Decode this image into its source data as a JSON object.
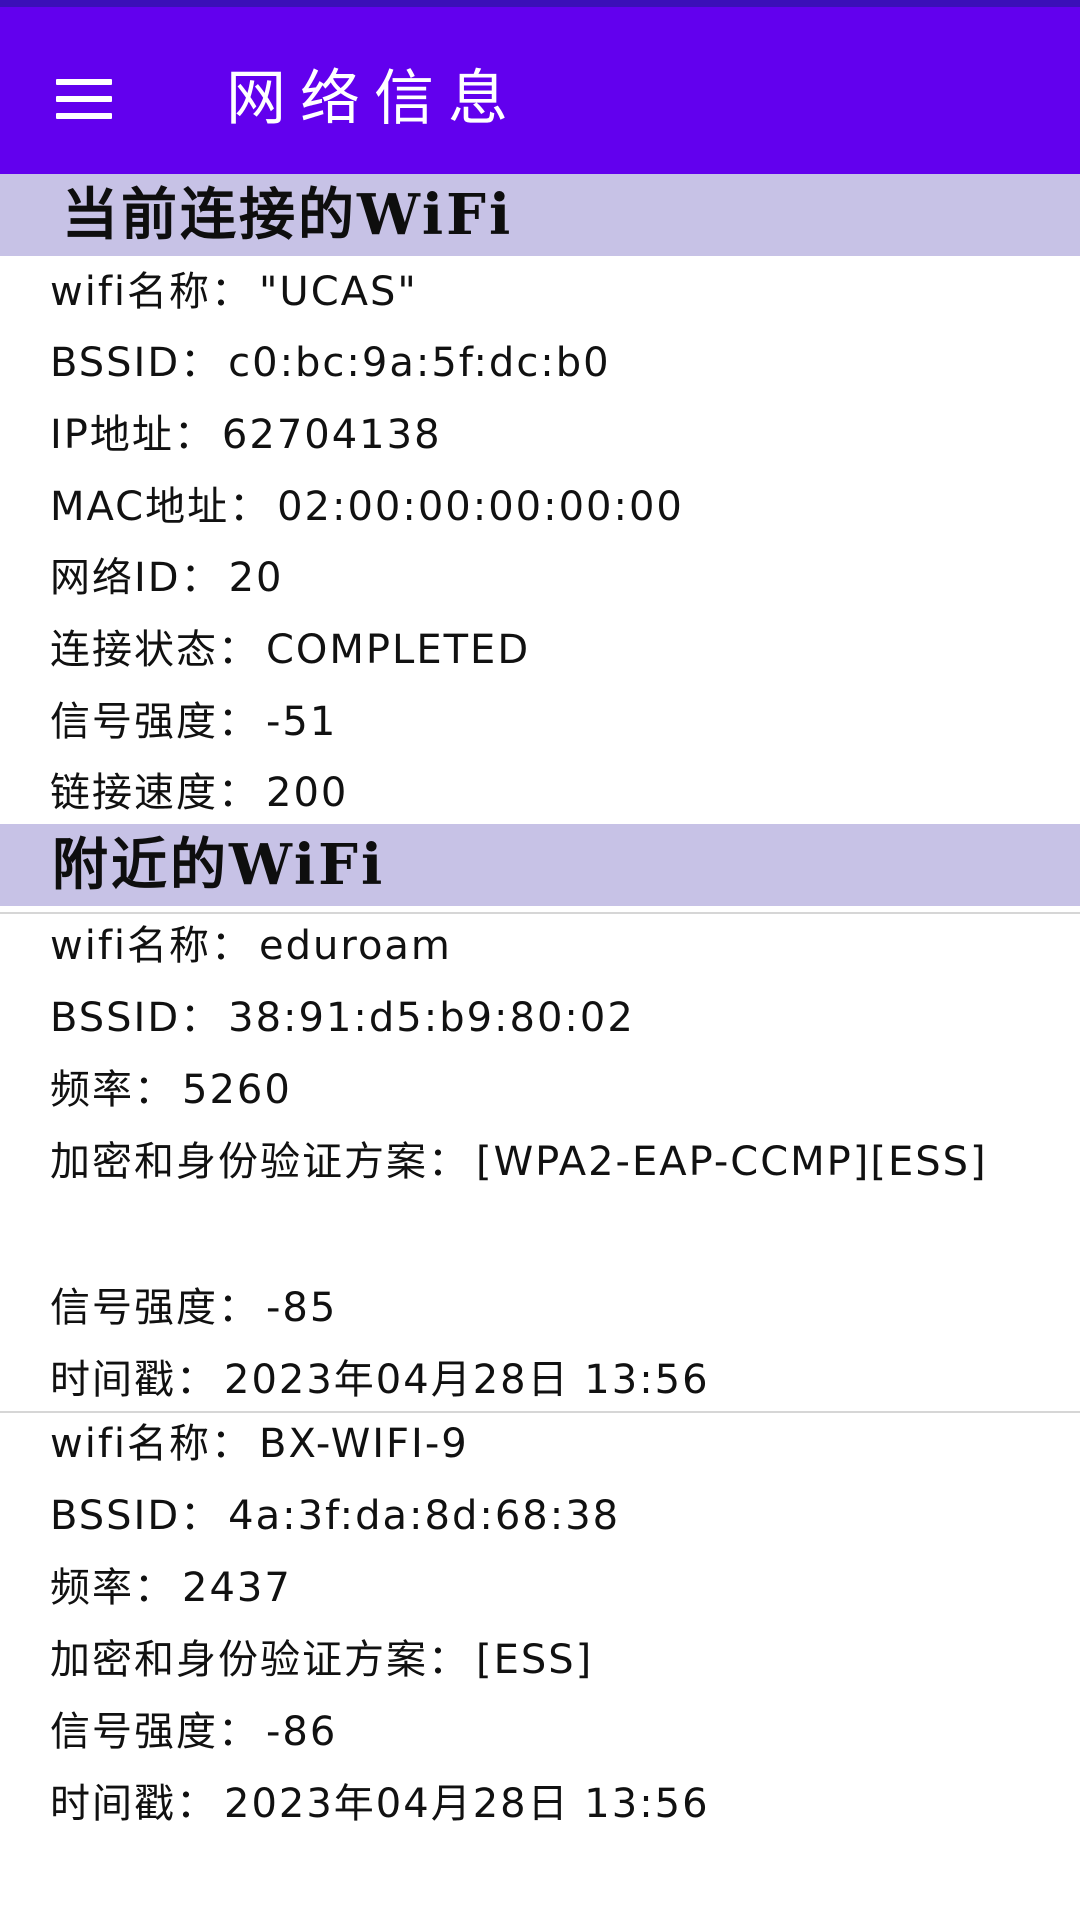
{
  "app_bar": {
    "title": "网络信息",
    "menu_icon": "hamburger-menu-icon"
  },
  "current_wifi": {
    "section_title": "当前连接的WiFi",
    "rows": [
      {
        "label": "wifi名称：",
        "value": "\"UCAS\""
      },
      {
        "label": "BSSID：",
        "value": "c0:bc:9a:5f:dc:b0"
      },
      {
        "label": "IP地址：",
        "value": "62704138"
      },
      {
        "label": "MAC地址：",
        "value": "02:00:00:00:00:00"
      },
      {
        "label": "网络ID：",
        "value": "20"
      },
      {
        "label": "连接状态：",
        "value": "COMPLETED"
      },
      {
        "label": "信号强度：",
        "value": "-51"
      },
      {
        "label": "链接速度：",
        "value": "200"
      }
    ]
  },
  "nearby_wifi": {
    "section_title": "附近的WiFi",
    "networks": [
      {
        "name_label": "wifi名称：",
        "name": "eduroam",
        "bssid_label": "BSSID：",
        "bssid": "38:91:d5:b9:80:02",
        "freq_label": "频率：",
        "freq": "5260",
        "security_label": "加密和身份验证方案：",
        "security": "[WPA2-EAP-CCMP][ESS]",
        "signal_label": "信号强度：",
        "signal": "-85",
        "time_label": "时间戳：",
        "time": "2023年04月28日 13:56"
      },
      {
        "name_label": "wifi名称：",
        "name": "BX-WIFI-9",
        "bssid_label": "BSSID：",
        "bssid": "4a:3f:da:8d:68:38",
        "freq_label": "频率：",
        "freq": "2437",
        "security_label": "加密和身份验证方案：",
        "security": "[ESS]",
        "signal_label": "信号强度：",
        "signal": "-86",
        "time_label": "时间戳：",
        "time": "2023年04月28日 13:56"
      }
    ]
  },
  "colors": {
    "app_bar": "#6200ee",
    "status_strip": "#3b0fb8",
    "section_header": "#c7c2e6",
    "divider": "#d6d6d6"
  }
}
